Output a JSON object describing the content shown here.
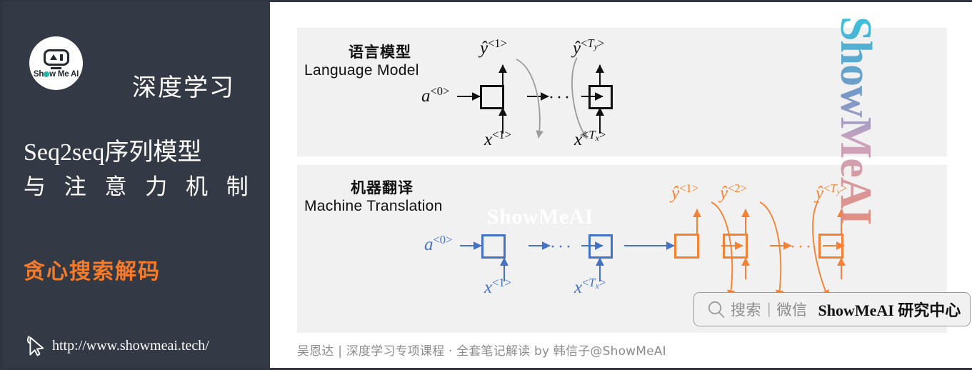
{
  "sidebar": {
    "logo": {
      "icon": "showmeai-robot-logo",
      "wordmark": "Show Me AI"
    },
    "title_line1": "深度学习",
    "title_line2": "Seq2seq序列模型",
    "title_line3": "与 注 意 力 机 制",
    "subtitle": "贪心搜索解码",
    "subtitle_color": "#f47b2a",
    "url": "http://www.showmeai.tech/",
    "cursor_icon": "mouse-cursor-icon",
    "background_color": "#343a45"
  },
  "watermark_vertical": {
    "text": "ShowMeAI",
    "gradient_start": "#29bcd8",
    "gradient_end": "#e58573"
  },
  "caption": "吴恩达 | 深度学习专项课程 · 全套笔记解读  by 韩信子@ShowMeAI",
  "search_bar": {
    "icon": "search-icon",
    "placeholder": "搜索",
    "divider": "|",
    "channel": "微信",
    "brand": "ShowMeAI 研究中心"
  },
  "diagrams": [
    {
      "id": "language-model",
      "title_cn": "语言模型",
      "title_en": "Language Model",
      "color": "#111111",
      "initial_state": {
        "base": "a",
        "sup": "<0>"
      },
      "ellipsis": "···",
      "cells": [
        {
          "output": {
            "base": "ŷ",
            "sup": "<1>"
          },
          "input": {
            "base": "x",
            "sup": "<1>"
          }
        },
        {
          "output": {
            "base": "ŷ",
            "sup": "<Ty>"
          },
          "input": {
            "base": "x",
            "sup": "<Tx>"
          }
        }
      ]
    },
    {
      "id": "machine-translation",
      "title_cn": "机器翻译",
      "title_en": "Machine Translation",
      "encoder_color": "#4472c4",
      "decoder_color": "#f58233",
      "inline_watermark": "ShowMeAI",
      "initial_state": {
        "base": "a",
        "sup": "<0>"
      },
      "ellipsis": "···",
      "encoder_cells": [
        {
          "input": {
            "base": "x",
            "sup": "<1>"
          }
        },
        {
          "input": {
            "base": "x",
            "sup": "<Tx>"
          }
        }
      ],
      "decoder_cells": [
        {
          "output": {
            "base": "ŷ",
            "sup": "<1>"
          }
        },
        {
          "output": {
            "base": "ŷ",
            "sup": "<2>"
          }
        },
        {
          "output": {
            "base": "ŷ",
            "sup": "<Ty>"
          }
        }
      ]
    }
  ]
}
